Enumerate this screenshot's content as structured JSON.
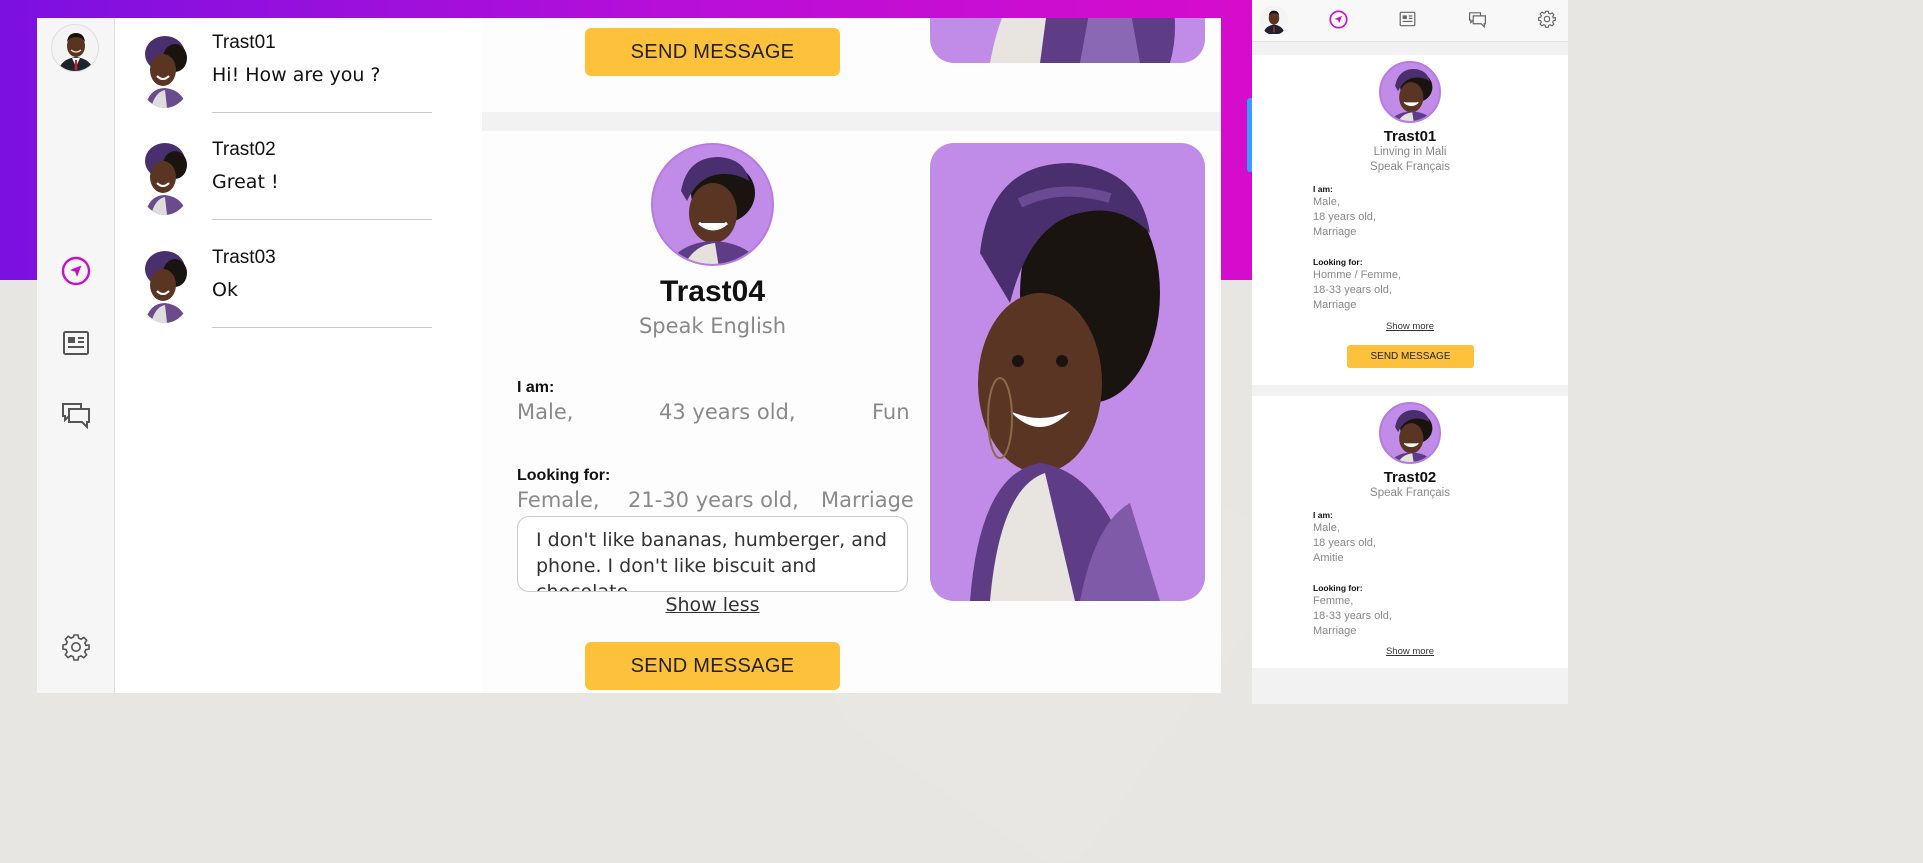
{
  "chats": [
    {
      "name": "Trast01",
      "message": "Hi! How are you ?"
    },
    {
      "name": "Trast02",
      "message": "Great !"
    },
    {
      "name": "Trast03",
      "message": "Ok"
    }
  ],
  "feed": {
    "top_card": {
      "send_label": "SEND MESSAGE"
    },
    "profile": {
      "name": "Trast04",
      "language": "Speak English",
      "i_am_label": "I am:",
      "i_am": [
        "Male,",
        "43 years old,",
        "Fun"
      ],
      "looking_label": "Looking for:",
      "looking": [
        "Female,",
        "21-30 years old,",
        "Marriage"
      ],
      "about": "I don't like bananas, humberger, and phone. I don't like biscuit and chocolate",
      "toggle_label": "Show less",
      "send_label": "SEND MESSAGE"
    }
  },
  "side": {
    "cards": [
      {
        "name": "Trast01",
        "location": "Linving in Mali",
        "language": "Speak Français",
        "i_am_label": "I am:",
        "i_am": [
          "Male,",
          "18 years old,",
          "Marriage"
        ],
        "looking_label": "Looking for:",
        "looking": [
          "Homme / Femme,",
          "18-33 years old,",
          "Marriage"
        ],
        "more_label": "Show more",
        "send_label": "SEND MESSAGE"
      },
      {
        "name": "Trast02",
        "language": "Speak Français",
        "i_am_label": "I am:",
        "i_am": [
          "Male,",
          "18 years old,",
          "Amitie"
        ],
        "looking_label": "Looking for:",
        "looking": [
          "Femme,",
          "18-33 years old,",
          "Marriage"
        ],
        "more_label": "Show more"
      }
    ]
  },
  "icons": {
    "nav": "navigation-compass-icon",
    "news": "newspaper-icon",
    "chat": "chat-bubbles-icon",
    "settings": "gear-icon"
  },
  "colors": {
    "accent": "#c80fcf",
    "button": "#fdc13b",
    "photo_bg": "#c18be8",
    "purple_top": "#7b10e0"
  }
}
